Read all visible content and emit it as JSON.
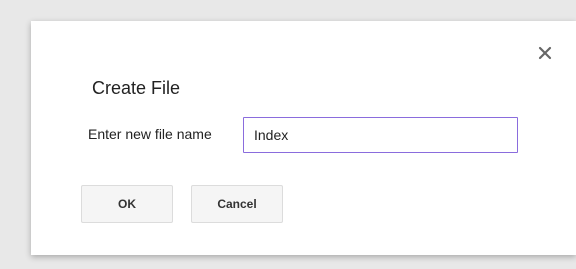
{
  "dialog": {
    "title": "Create File",
    "close_icon": "close-icon",
    "field_label": "Enter new file name",
    "input_value": "Index",
    "ok_label": "OK",
    "cancel_label": "Cancel"
  },
  "colors": {
    "backdrop": "#e8e8e8",
    "dialog_bg": "#ffffff",
    "input_focus_border": "#8a6cdd",
    "button_bg": "#f5f5f5"
  }
}
